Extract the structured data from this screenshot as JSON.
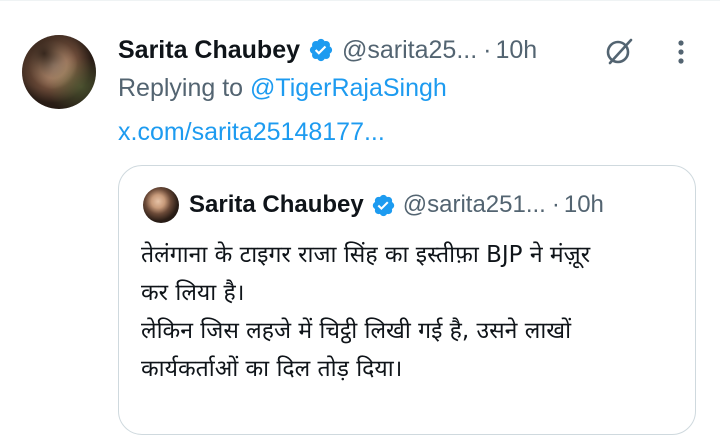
{
  "tweet": {
    "display_name": "Sarita Chaubey",
    "handle": "@sarita25...",
    "separator": "·",
    "time": "10h",
    "replying_prefix": "Replying to ",
    "replying_mention": "@TigerRajaSingh",
    "link_text": "x.com/sarita25148177..."
  },
  "quote": {
    "display_name": "Sarita Chaubey",
    "handle": "@sarita251...",
    "separator": "·",
    "time": "10h",
    "lines": [
      "तेलंगाना के टाइगर राजा सिंह का इस्तीफ़ा BJP ने मंज़ूर",
      "कर लिया है।",
      "लेकिन जिस लहजे में चिट्ठी लिखी गई है, उसने लाखों",
      "कार्यकर्ताओं का दिल तोड़ दिया।"
    ]
  },
  "colors": {
    "accent": "#1d9bf0",
    "secondary_text": "#536471",
    "border": "#cfd9de"
  },
  "icons": [
    "verified-badge-icon",
    "grok-icon",
    "more-options-icon"
  ]
}
